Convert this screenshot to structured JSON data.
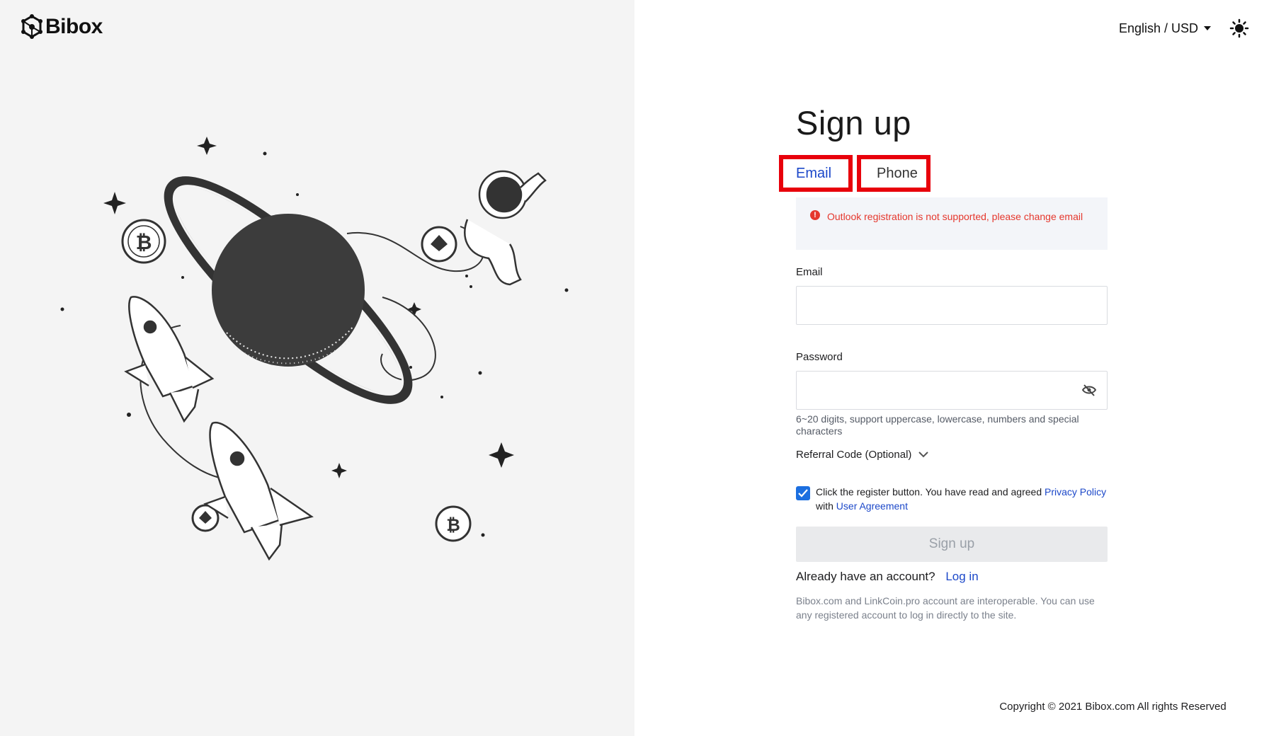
{
  "brand": {
    "name": "Bibox"
  },
  "topbar": {
    "language": "English / USD",
    "theme_icon": "sun-icon"
  },
  "form": {
    "title": "Sign up",
    "tabs": [
      {
        "label": "Email",
        "active": true
      },
      {
        "label": "Phone",
        "active": false
      }
    ],
    "alert": "Outlook registration is not supported, please change email",
    "email_label": "Email",
    "email_value": "",
    "password_label": "Password",
    "password_value": "",
    "password_hint": "6~20 digits, support uppercase, lowercase, numbers and special characters",
    "referral_label": "Referral Code (Optional)",
    "agree_prefix": "Click the register button. You have read and agreed",
    "privacy_link": "Privacy Policy",
    "agree_with": "with",
    "agreement_link": "User Agreement",
    "agree_checked": true,
    "submit_label": "Sign up",
    "login_prompt": "Already have an account?",
    "login_link": "Log in",
    "note": "Bibox.com and LinkCoin.pro account are interoperable. You can use any registered account to log in directly to the site."
  },
  "footer": {
    "copyright": "Copyright © 2021 Bibox.com All rights Reserved"
  },
  "colors": {
    "accent": "#1c48c9",
    "error": "#e5372d",
    "highlight_box": "#e8000b",
    "left_bg": "#f4f4f4"
  }
}
